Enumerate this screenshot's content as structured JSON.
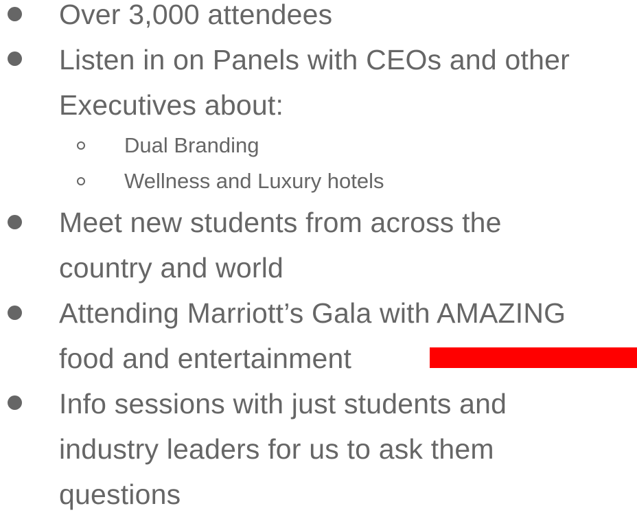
{
  "bullets": [
    {
      "lines": [
        "Over 3,000 attendees"
      ]
    },
    {
      "lines": [
        "Listen in on Panels with CEOs and other",
        "Executives about:"
      ],
      "sub_items": [
        "Dual Branding",
        "Wellness and Luxury hotels"
      ]
    },
    {
      "lines": [
        "Meet new students from across the",
        "country and world"
      ]
    },
    {
      "lines": [
        "Attending Marriott’s Gala with AMAZING",
        "food and entertainment"
      ]
    },
    {
      "lines": [
        "Info sessions with just students and",
        "industry leaders for us to ask them",
        "questions"
      ]
    }
  ],
  "colors": {
    "text": "#666666",
    "highlight_bar": "#ff0000"
  }
}
